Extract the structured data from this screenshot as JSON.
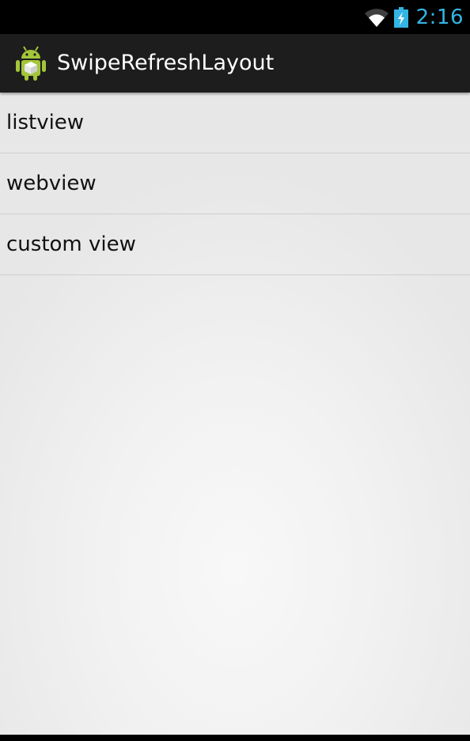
{
  "status_bar": {
    "time": "2:16",
    "icons": [
      "wifi-icon",
      "battery-charging-icon"
    ],
    "accent_color": "#33b5e5"
  },
  "action_bar": {
    "title": "SwipeRefreshLayout",
    "icon": "android-robot-icon",
    "background": "#1d1d1d"
  },
  "list": {
    "items": [
      {
        "label": "listview"
      },
      {
        "label": "webview"
      },
      {
        "label": "custom view"
      }
    ]
  }
}
